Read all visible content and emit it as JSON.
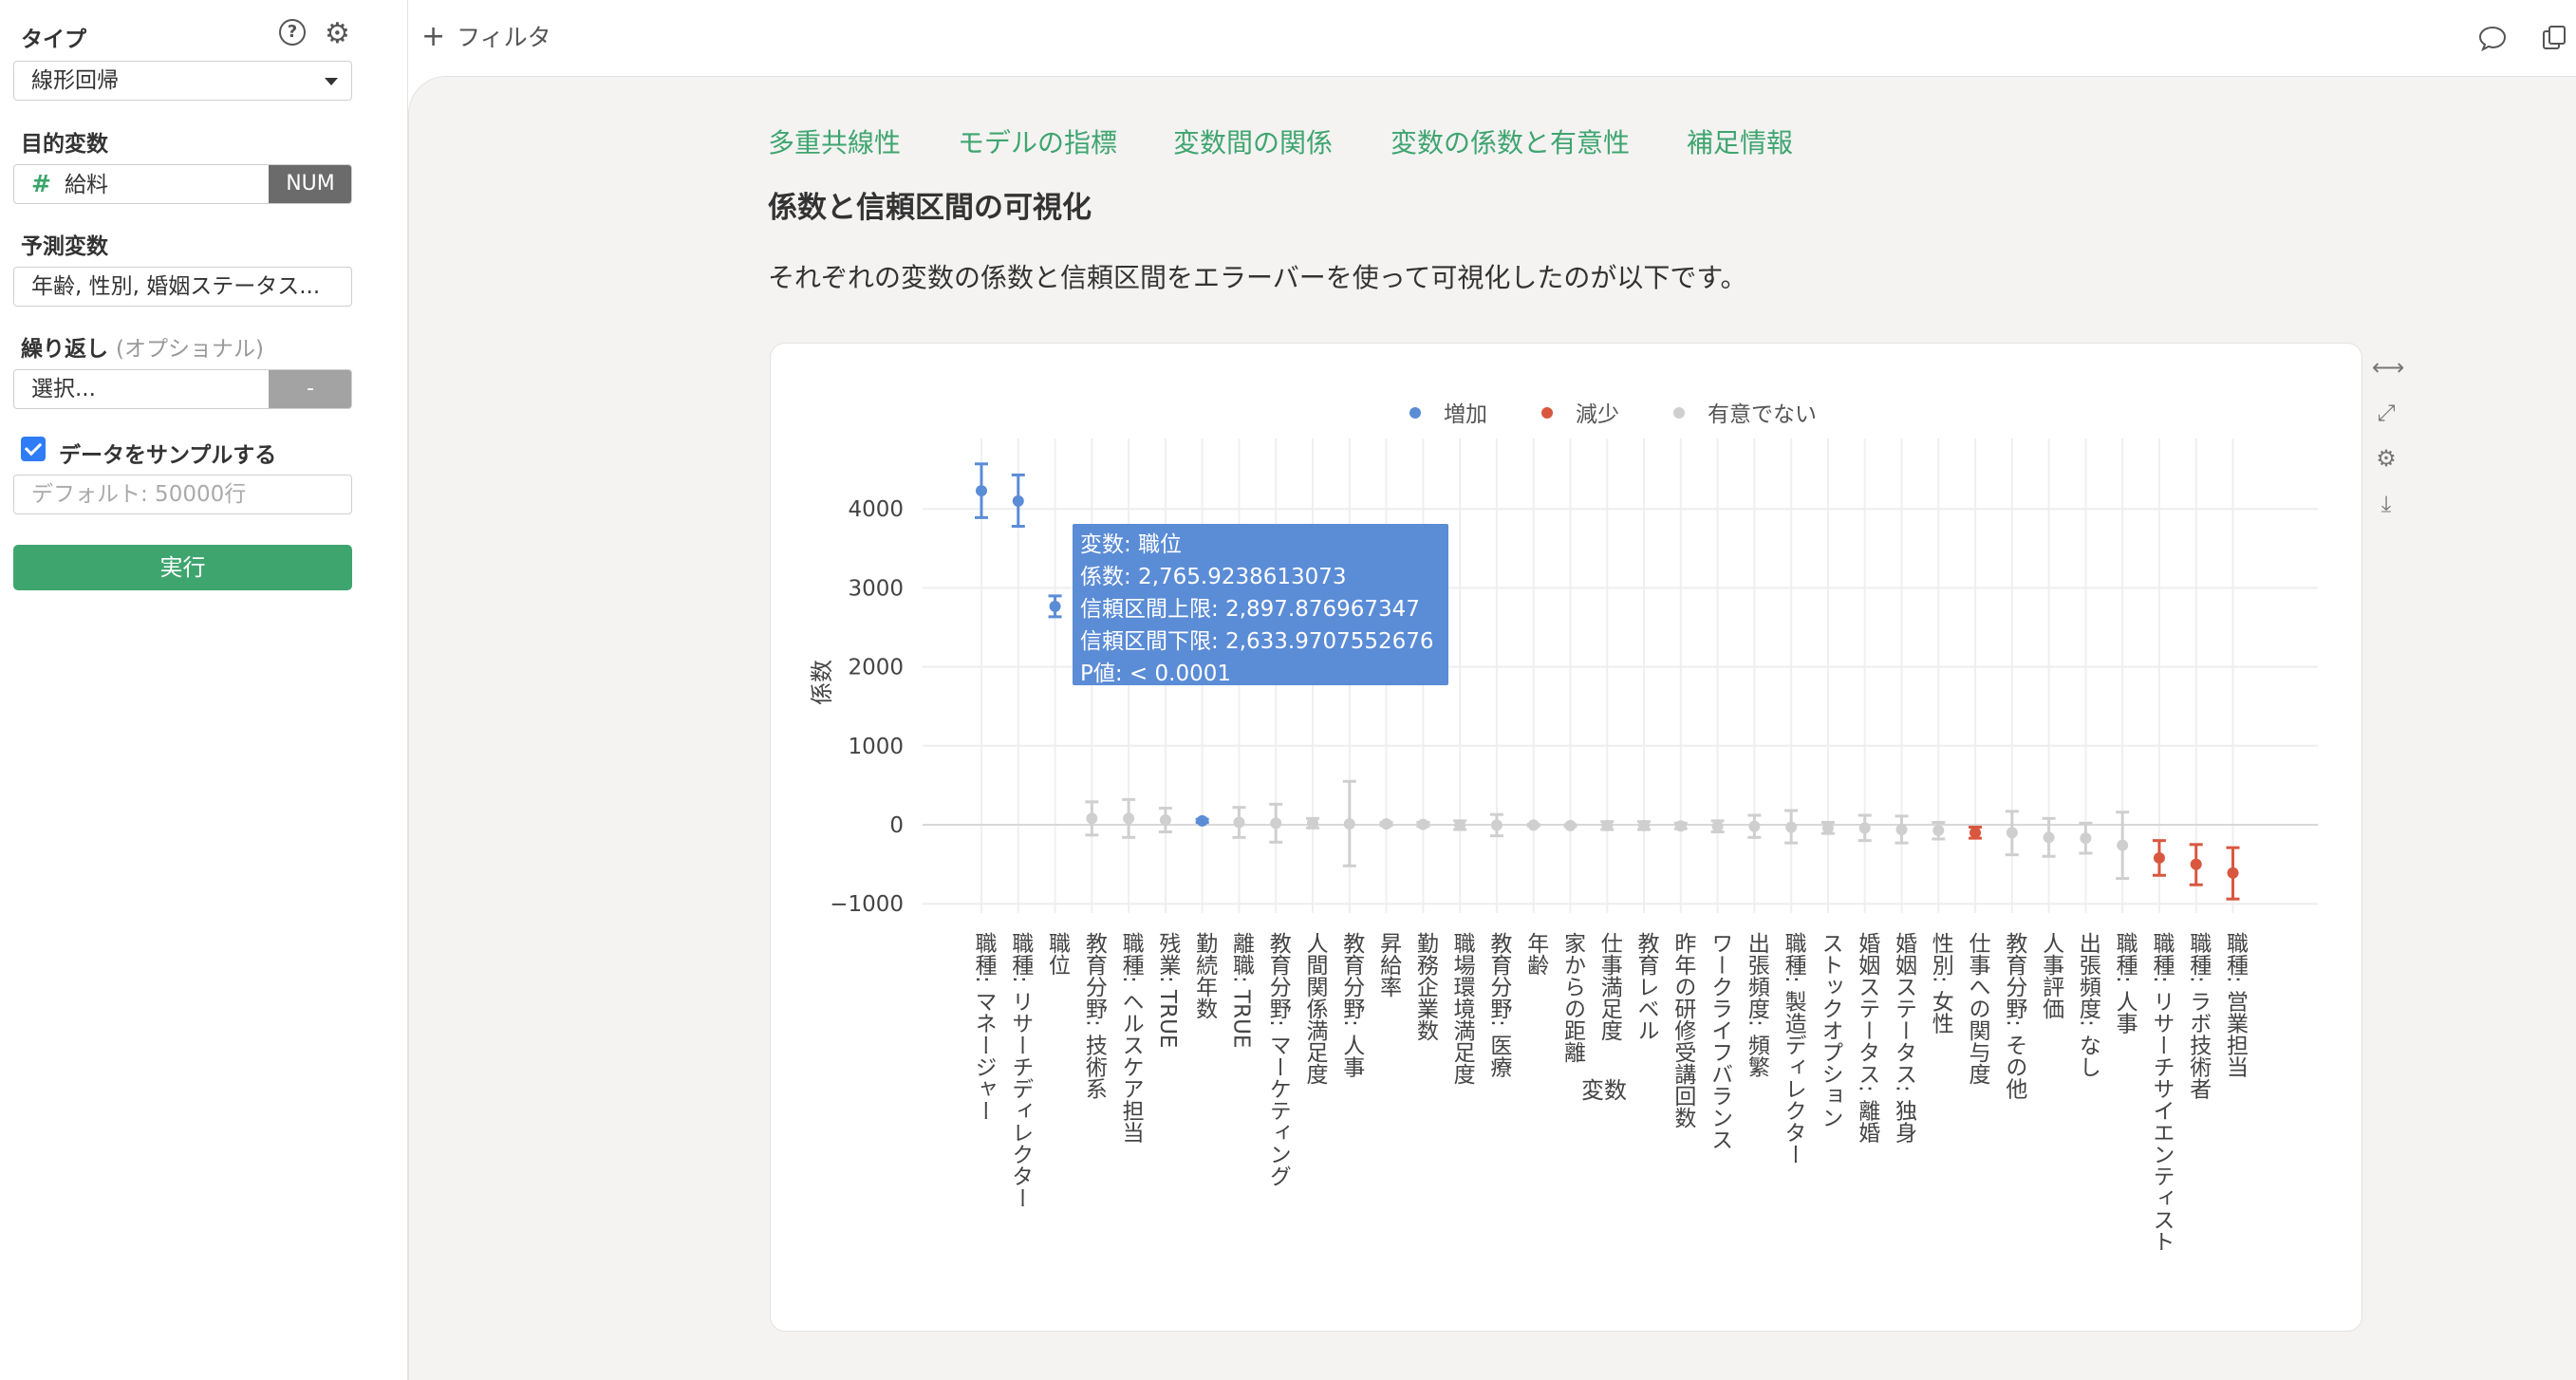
{
  "sidebar": {
    "type_label": "タイプ",
    "type_value": "線形回帰",
    "target_label": "目的変数",
    "target_value": "給料",
    "target_badge": "NUM",
    "predictor_label": "予測変数",
    "predictor_value": "年齢, 性別, 婚姻ステータス...",
    "repeat_label": "繰り返し",
    "repeat_optional": "(オプショナル)",
    "repeat_placeholder": "選択...",
    "repeat_badge": "-",
    "sample_label": "データをサンプルする",
    "sample_placeholder": "デフォルト: 50000行",
    "run_label": "実行"
  },
  "topbar": {
    "filter_label": "フィルタ"
  },
  "tabs": [
    "多重共線性",
    "モデルの指標",
    "変数間の関係",
    "変数の係数と有意性",
    "補足情報"
  ],
  "section_title": "係数と信頼区間の可視化",
  "description": "それぞれの変数の係数と信頼区間をエラーバーを使って可視化したのが以下です。",
  "colors": {
    "increase": "#5b8cd6",
    "decrease": "#d9573f",
    "nonsig": "#cfcfcf",
    "accent": "#3fa56f"
  },
  "tooltip": {
    "lines": [
      "変数: 職位",
      "係数: 2,765.9238613073",
      "信頼区間上限: 2,897.876967347",
      "信頼区間下限: 2,633.9707552676",
      "P値: < 0.0001"
    ]
  },
  "chart_data": {
    "type": "scatter",
    "title": "",
    "xlabel": "変数",
    "ylabel": "係数",
    "ylim": [
      -1000,
      4500
    ],
    "yticks": [
      -1000,
      0,
      1000,
      2000,
      3000,
      4000
    ],
    "legend": [
      "増加",
      "減少",
      "有意でない"
    ],
    "legend_position": "top-center",
    "points": [
      {
        "label": "職種: マネージャー",
        "value": 4230,
        "lower": 3890,
        "upper": 4570,
        "group": "increase"
      },
      {
        "label": "職種: リサーチディレクター",
        "value": 4100,
        "lower": 3780,
        "upper": 4430,
        "group": "increase"
      },
      {
        "label": "職位",
        "value": 2766,
        "lower": 2634,
        "upper": 2898,
        "group": "increase"
      },
      {
        "label": "教育分野: 技術系",
        "value": 80,
        "lower": -130,
        "upper": 290,
        "group": "nonsig"
      },
      {
        "label": "職種: ヘルスケア担当",
        "value": 80,
        "lower": -160,
        "upper": 320,
        "group": "nonsig"
      },
      {
        "label": "残業: TRUE",
        "value": 60,
        "lower": -90,
        "upper": 210,
        "group": "nonsig"
      },
      {
        "label": "勤続年数",
        "value": 50,
        "lower": 30,
        "upper": 70,
        "group": "increase"
      },
      {
        "label": "離職: TRUE",
        "value": 30,
        "lower": -160,
        "upper": 220,
        "group": "nonsig"
      },
      {
        "label": "教育分野: マーケティング",
        "value": 20,
        "lower": -220,
        "upper": 260,
        "group": "nonsig"
      },
      {
        "label": "人間関係満足度",
        "value": 20,
        "lower": -40,
        "upper": 80,
        "group": "nonsig"
      },
      {
        "label": "教育分野: 人事",
        "value": 10,
        "lower": -520,
        "upper": 550,
        "group": "nonsig"
      },
      {
        "label": "昇給率",
        "value": 10,
        "lower": -10,
        "upper": 30,
        "group": "nonsig"
      },
      {
        "label": "勤務企業数",
        "value": 5,
        "lower": -20,
        "upper": 30,
        "group": "nonsig"
      },
      {
        "label": "職場環境満足度",
        "value": -5,
        "lower": -60,
        "upper": 50,
        "group": "nonsig"
      },
      {
        "label": "教育分野: 医療",
        "value": -5,
        "lower": -140,
        "upper": 130,
        "group": "nonsig"
      },
      {
        "label": "年齢",
        "value": -5,
        "lower": -15,
        "upper": 5,
        "group": "nonsig"
      },
      {
        "label": "家からの距離",
        "value": -10,
        "lower": -20,
        "upper": 0,
        "group": "nonsig"
      },
      {
        "label": "仕事満足度",
        "value": -10,
        "lower": -60,
        "upper": 40,
        "group": "nonsig"
      },
      {
        "label": "教育レベル",
        "value": -10,
        "lower": -60,
        "upper": 40,
        "group": "nonsig"
      },
      {
        "label": "昨年の研修受講回数",
        "value": -15,
        "lower": -50,
        "upper": 20,
        "group": "nonsig"
      },
      {
        "label": "ワークライフバランス",
        "value": -20,
        "lower": -90,
        "upper": 50,
        "group": "nonsig"
      },
      {
        "label": "出張頻度: 頻繁",
        "value": -20,
        "lower": -160,
        "upper": 120,
        "group": "nonsig"
      },
      {
        "label": "職種: 製造ディレクター",
        "value": -30,
        "lower": -230,
        "upper": 180,
        "group": "nonsig"
      },
      {
        "label": "ストックオプション",
        "value": -40,
        "lower": -110,
        "upper": 30,
        "group": "nonsig"
      },
      {
        "label": "婚姻ステータス: 離婚",
        "value": -40,
        "lower": -200,
        "upper": 120,
        "group": "nonsig"
      },
      {
        "label": "婚姻ステータス: 独身",
        "value": -60,
        "lower": -230,
        "upper": 110,
        "group": "nonsig"
      },
      {
        "label": "性別: 女性",
        "value": -70,
        "lower": -180,
        "upper": 30,
        "group": "nonsig"
      },
      {
        "label": "仕事への関与度",
        "value": -100,
        "lower": -170,
        "upper": -30,
        "group": "decrease"
      },
      {
        "label": "教育分野: その他",
        "value": -100,
        "lower": -380,
        "upper": 170,
        "group": "nonsig"
      },
      {
        "label": "人事評価",
        "value": -160,
        "lower": -400,
        "upper": 80,
        "group": "nonsig"
      },
      {
        "label": "出張頻度: なし",
        "value": -170,
        "lower": -360,
        "upper": 20,
        "group": "nonsig"
      },
      {
        "label": "職種: 人事",
        "value": -260,
        "lower": -680,
        "upper": 160,
        "group": "nonsig"
      },
      {
        "label": "職種: リサーチサイエンティスト",
        "value": -420,
        "lower": -640,
        "upper": -200,
        "group": "decrease"
      },
      {
        "label": "職種: ラボ技術者",
        "value": -500,
        "lower": -760,
        "upper": -250,
        "group": "decrease"
      },
      {
        "label": "職種: 営業担当",
        "value": -610,
        "lower": -940,
        "upper": -290,
        "group": "decrease"
      }
    ]
  }
}
